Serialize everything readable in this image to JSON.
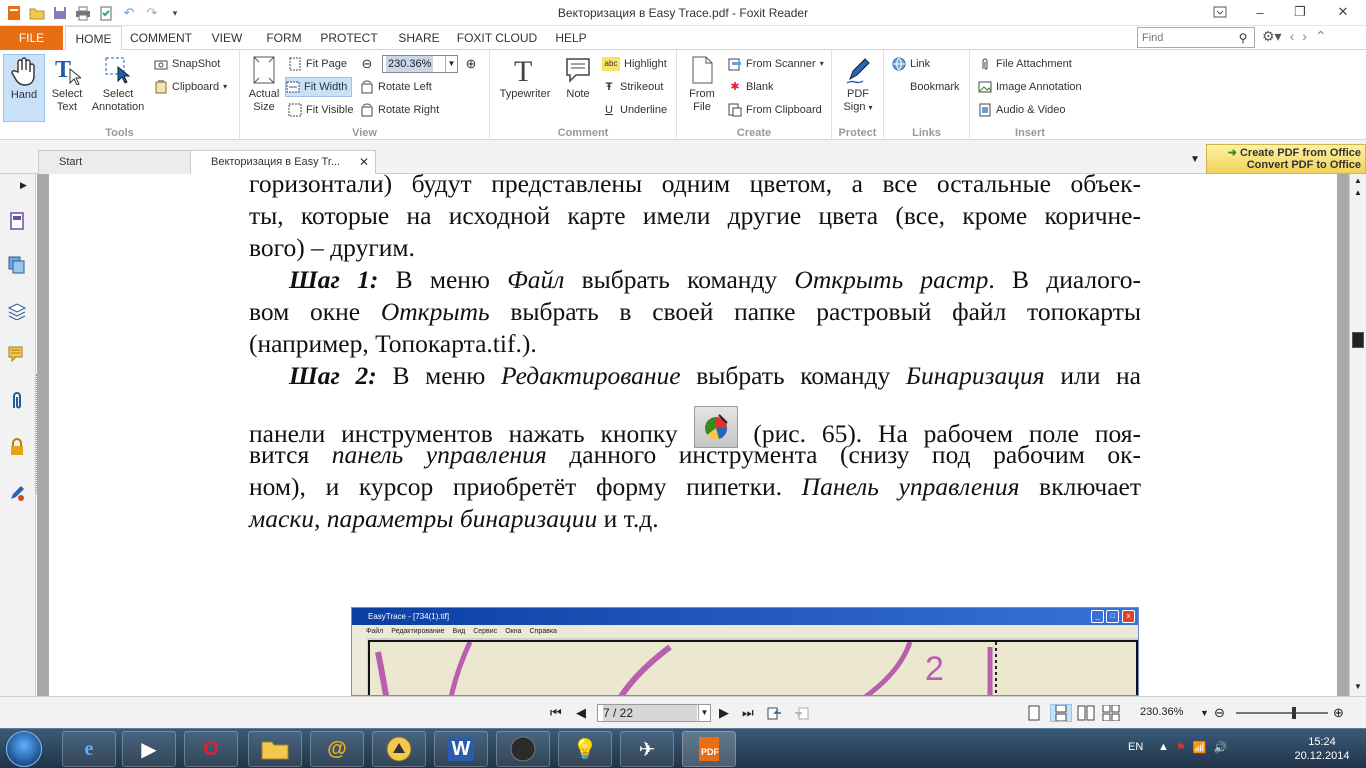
{
  "window": {
    "title": "Векторизация в Easy Trace.pdf - Foxit Reader",
    "min": "–",
    "max": "❐",
    "close": "✕"
  },
  "qat": [
    "pdf-app-icon",
    "open-icon",
    "save-icon",
    "print-icon",
    "clipboard-icon",
    "undo-icon",
    "redo-icon",
    "customize-icon"
  ],
  "tabs": {
    "file": "FILE",
    "items": [
      "HOME",
      "COMMENT",
      "VIEW",
      "FORM",
      "PROTECT",
      "SHARE",
      "FOXIT CLOUD",
      "HELP"
    ]
  },
  "find": {
    "placeholder": "Find",
    "icon": "search-icon"
  },
  "ribbon": {
    "tools": {
      "label": "Tools",
      "hand": "Hand",
      "select_text": "Select\nText",
      "select_text_l1": "Select",
      "select_text_l2": "Text",
      "select_ann_l1": "Select",
      "select_ann_l2": "Annotation",
      "snapshot": "SnapShot",
      "clipboard": "Clipboard"
    },
    "view": {
      "label": "View",
      "actual_l1": "Actual",
      "actual_l2": "Size",
      "fit_page": "Fit Page",
      "fit_width": "Fit Width",
      "fit_visible": "Fit Visible",
      "zoom_value": "230.36%",
      "rotate_left": "Rotate Left",
      "rotate_right": "Rotate Right"
    },
    "comment": {
      "label": "Comment",
      "typewriter": "Typewriter",
      "note": "Note",
      "highlight": "Highlight",
      "strikeout": "Strikeout",
      "underline": "Underline"
    },
    "create": {
      "label": "Create",
      "from_file_l1": "From",
      "from_file_l2": "File",
      "from_scanner": "From Scanner",
      "blank": "Blank",
      "from_clipboard": "From Clipboard"
    },
    "protect": {
      "label": "Protect",
      "pdf_sign_l1": "PDF",
      "pdf_sign_l2": "Sign"
    },
    "links": {
      "label": "Links",
      "link": "Link",
      "bookmark": "Bookmark"
    },
    "insert": {
      "label": "Insert",
      "file_attachment": "File Attachment",
      "image_annotation": "Image Annotation",
      "audio_video": "Audio & Video"
    }
  },
  "doc_tabs": {
    "start": "Start",
    "current": "Векторизация в Easy Tr..."
  },
  "ad_banner": {
    "line1": "Create PDF from Office",
    "line2": "Convert PDF to Office"
  },
  "document": {
    "l1": "горизонтали) будут представлены одним цветом, а все остальные объек-",
    "l2": "ты, которые на исходной карте имели другие цвета (все, кроме коричне-",
    "l3": "вого) – другим.",
    "l4_b": "Шаг 1:",
    "l4_t1": " В меню ",
    "l4_i1": "Файл",
    "l4_t2": " выбрать команду ",
    "l4_i2": "Открыть растр",
    "l4_t3": ". В диалого-",
    "l5_t1": "вом окне ",
    "l5_i1": "Открыть",
    "l5_t2": " выбрать в своей папке растровый файл топокарты",
    "l6": "(например, Топокарта.tif.).",
    "l7_b": "Шаг 2:",
    "l7_t1": " В меню ",
    "l7_i1": "Редактирование",
    "l7_t2": " выбрать команду ",
    "l7_i2": "Бинаризация",
    "l7_t3": " или на",
    "l8_t1": "панели инструментов нажать кнопку ",
    "l8_t2": " (рис. 65). На рабочем поле поя-",
    "l9_t1": "вится ",
    "l9_i1": "панель управления",
    "l9_t2": " данного инструмента (снизу под рабочим ок-",
    "l10_t1": "ном), и курсор приобретёт форму пипетки. ",
    "l10_i1": "Панель управления",
    "l10_t2": " включает",
    "l11_i1": "маски, параметры бинаризации",
    "l11_t1": " и т.д."
  },
  "screenshot": {
    "title": "EasyTrace - [734(1).tif]",
    "menu": [
      "Файл",
      "Редактирование",
      "Вид",
      "Сервис",
      "Окна",
      "Справка"
    ]
  },
  "statusbar": {
    "page": "7 / 22",
    "zoom": "230.36%"
  },
  "taskbar": {
    "lang": "EN",
    "time": "15:24",
    "date": "20.12.2014"
  },
  "colors": {
    "accent": "#e96d12",
    "selection": "#c8e0f8"
  }
}
